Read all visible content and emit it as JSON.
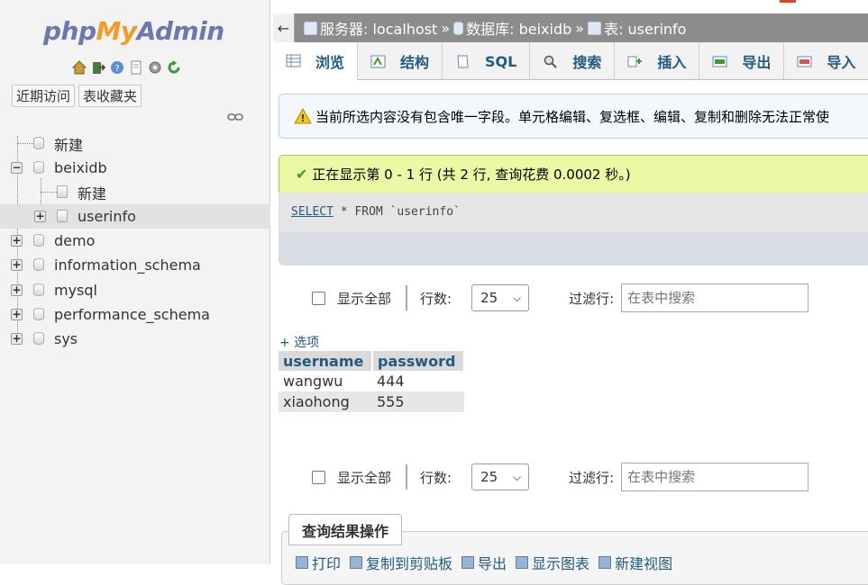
{
  "nav": {
    "logo": {
      "php": "php",
      "my": "My",
      "admin": "Admin"
    },
    "icons": [
      "home-icon",
      "exit-icon",
      "help-icon",
      "docs-icon",
      "settings-icon",
      "reload-icon"
    ],
    "tabs": [
      "近期访问",
      "表收藏夹"
    ],
    "tree": [
      {
        "label": "新建",
        "level": 0,
        "type": "new"
      },
      {
        "label": "beixidb",
        "level": 0,
        "type": "db",
        "expanded": true
      },
      {
        "label": "新建",
        "level": 1,
        "type": "new"
      },
      {
        "label": "userinfo",
        "level": 1,
        "type": "table",
        "selected": true
      },
      {
        "label": "demo",
        "level": 0,
        "type": "db"
      },
      {
        "label": "information_schema",
        "level": 0,
        "type": "db"
      },
      {
        "label": "mysql",
        "level": 0,
        "type": "db"
      },
      {
        "label": "performance_schema",
        "level": 0,
        "type": "db"
      },
      {
        "label": "sys",
        "level": 0,
        "type": "db"
      }
    ]
  },
  "breadcrumb": {
    "back": "←",
    "server": "服务器: localhost",
    "database": "数据库: beixidb",
    "table": "表: userinfo",
    "separator": "»"
  },
  "tabs": [
    {
      "label": "浏览",
      "icon": "browse-icon",
      "active": true
    },
    {
      "label": "结构",
      "icon": "structure-icon"
    },
    {
      "label": "SQL",
      "icon": "sql-icon"
    },
    {
      "label": "搜索",
      "icon": "search-icon"
    },
    {
      "label": "插入",
      "icon": "insert-icon"
    },
    {
      "label": "导出",
      "icon": "export-icon"
    },
    {
      "label": "导入",
      "icon": "import-icon"
    }
  ],
  "warning": "当前所选内容没有包含唯一字段。单元格编辑、复选框、编辑、复制和删除无法正常使",
  "success": "正在显示第 0 - 1 行 (共 2 行, 查询花费 0.0002 秒。)",
  "sql": {
    "keyword1": "SELECT",
    "rest": " * FROM `userinfo`"
  },
  "controls": {
    "show_all": "显示全部",
    "rows_label": "行数:",
    "rows_value": "25",
    "filter_label": "过滤行:",
    "filter_placeholder": "在表中搜索"
  },
  "options_link": "+ 选项",
  "table": {
    "columns": [
      "username",
      "password"
    ],
    "rows": [
      [
        "wangwu",
        "444"
      ],
      [
        "xiaohong",
        "555"
      ]
    ]
  },
  "query_ops": {
    "title": "查询结果操作",
    "links": [
      "打印",
      "复制到剪贴板",
      "导出",
      "显示图表",
      "新建视图"
    ]
  },
  "colors": {
    "accent": "#235a81",
    "success_bg": "#ebf8a4",
    "breadcrumb_bg": "#8c8c8c"
  }
}
